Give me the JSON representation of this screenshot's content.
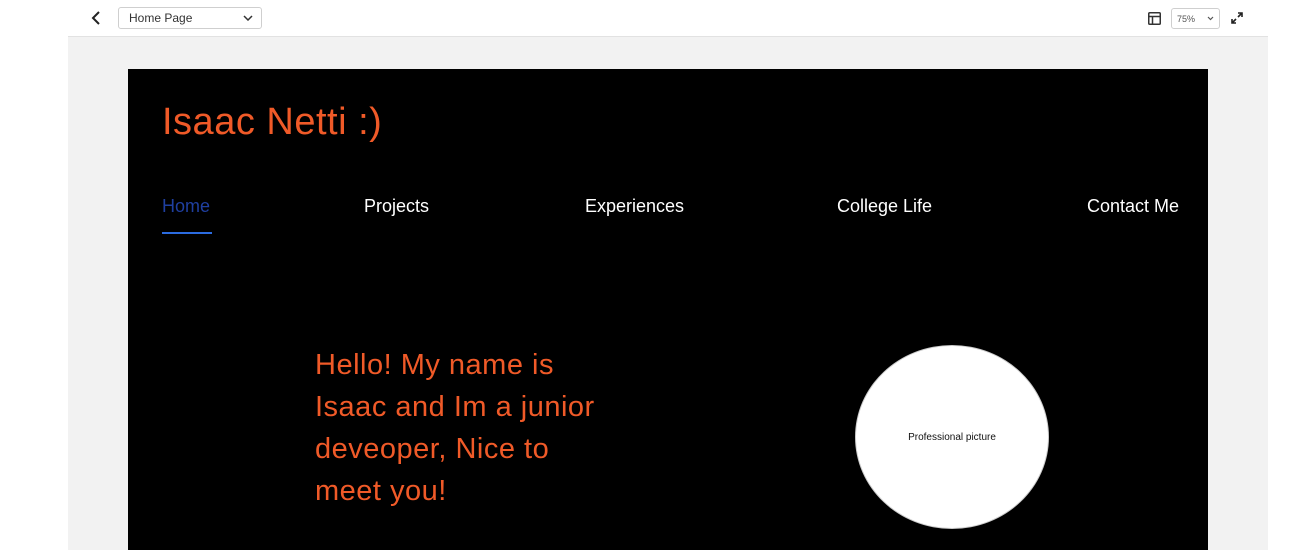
{
  "toolbar": {
    "back_icon": "chevron-left-icon",
    "page_select_value": "Home Page",
    "layout_icon": "layout-panel-icon",
    "zoom_value": "75%",
    "expand_icon": "expand-icon"
  },
  "site": {
    "title": "Isaac Netti :)",
    "nav": {
      "home": "Home",
      "projects": "Projects",
      "experiences": "Experiences",
      "college_life": "College Life",
      "contact": "Contact Me"
    },
    "intro_text": "Hello! My name is Isaac and Im a junior deveoper, Nice to meet you!",
    "photo_placeholder": "Professional picture"
  },
  "colors": {
    "accent": "#f05a28",
    "active_nav": "#1f3fa0",
    "underline": "#2b6be0",
    "site_bg": "#000000"
  }
}
